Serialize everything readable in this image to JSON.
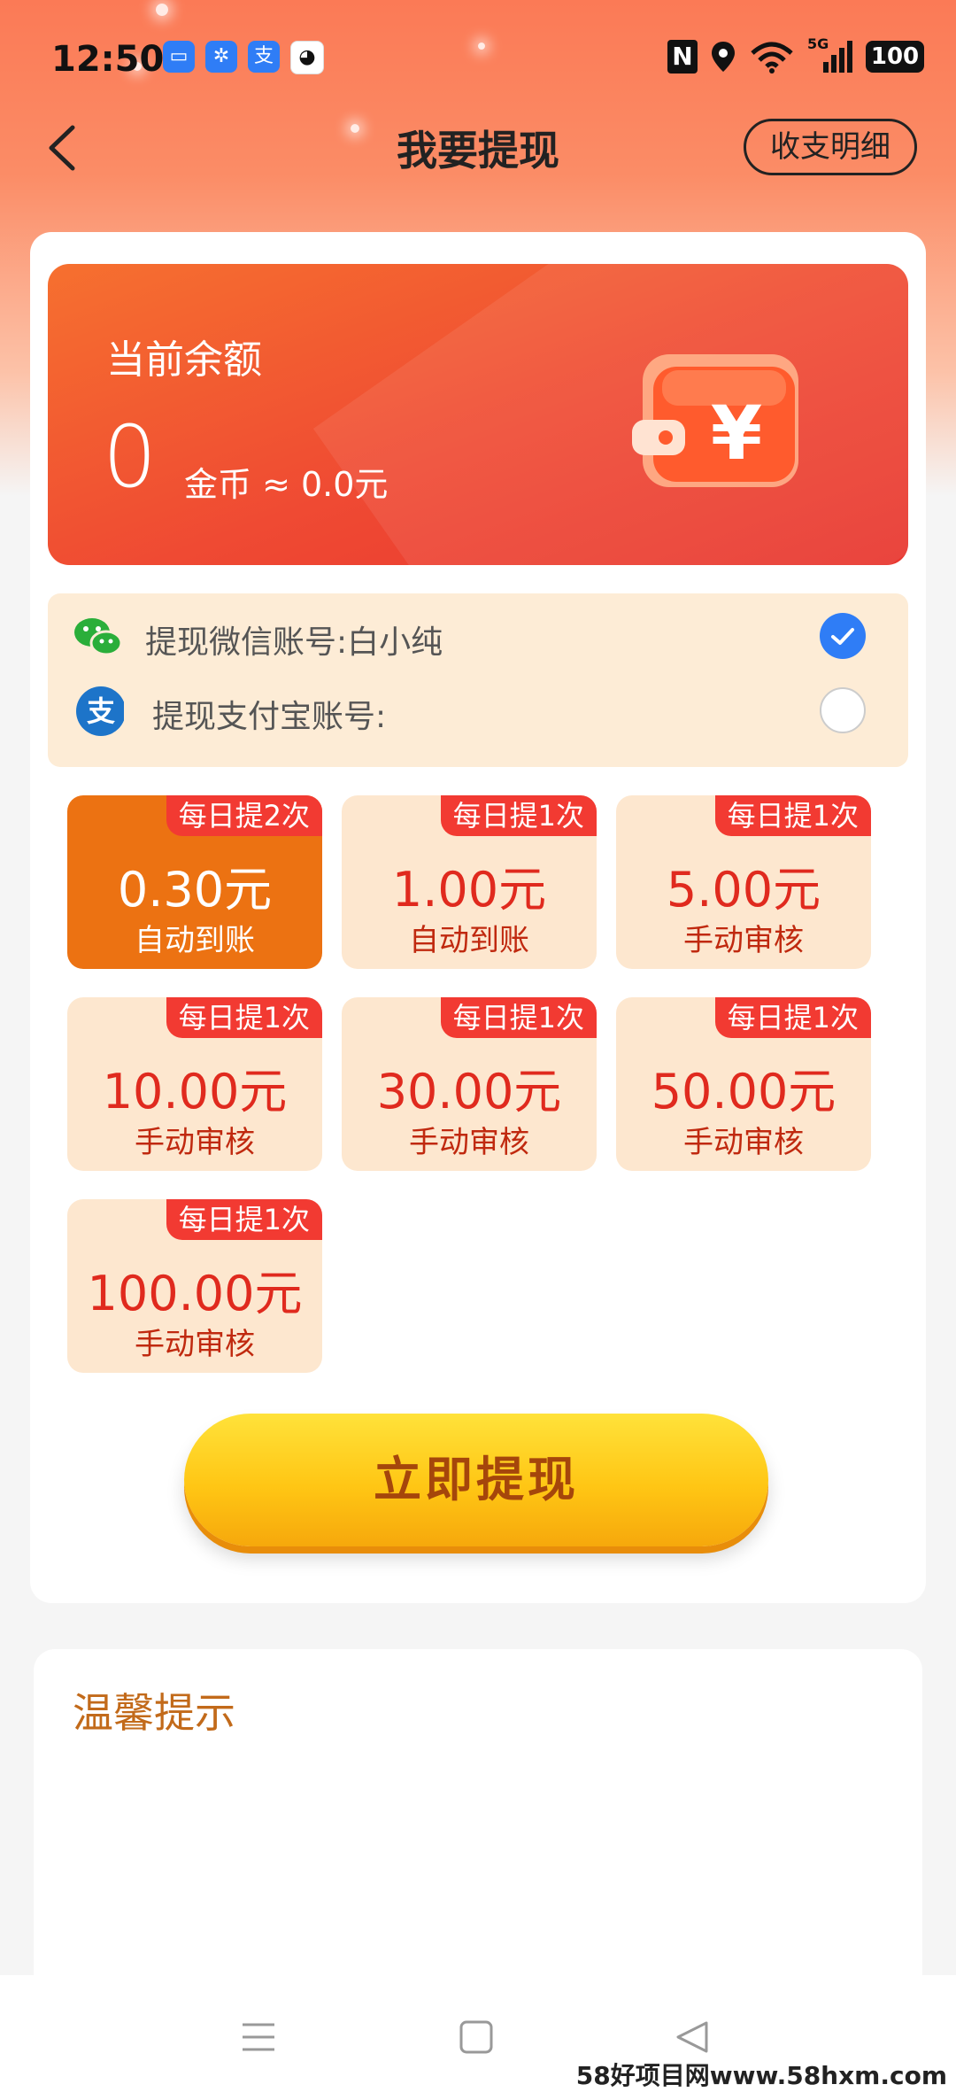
{
  "status_bar": {
    "time": "12:50",
    "nfc": "N",
    "network": "5G",
    "battery": "100"
  },
  "header": {
    "title": "我要提现",
    "detail_button": "收支明细"
  },
  "balance": {
    "label": "当前余额",
    "amount": "0",
    "unit_text": "金币 ≈ 0.0元"
  },
  "accounts": [
    {
      "label": "提现微信账号:白小纯",
      "selected": true
    },
    {
      "label": "提现支付宝账号:",
      "selected": false
    }
  ],
  "options": [
    {
      "tag": "每日提2次",
      "amount": "0.30元",
      "mode": "自动到账",
      "active": true
    },
    {
      "tag": "每日提1次",
      "amount": "1.00元",
      "mode": "自动到账",
      "active": false
    },
    {
      "tag": "每日提1次",
      "amount": "5.00元",
      "mode": "手动审核",
      "active": false
    },
    {
      "tag": "每日提1次",
      "amount": "10.00元",
      "mode": "手动审核",
      "active": false
    },
    {
      "tag": "每日提1次",
      "amount": "30.00元",
      "mode": "手动审核",
      "active": false
    },
    {
      "tag": "每日提1次",
      "amount": "50.00元",
      "mode": "手动审核",
      "active": false
    },
    {
      "tag": "每日提1次",
      "amount": "100.00元",
      "mode": "手动审核",
      "active": false
    }
  ],
  "withdraw_button": "立即提现",
  "tips": {
    "title": "温馨提示"
  },
  "watermark": "58好项目网www.58hxm.com"
}
